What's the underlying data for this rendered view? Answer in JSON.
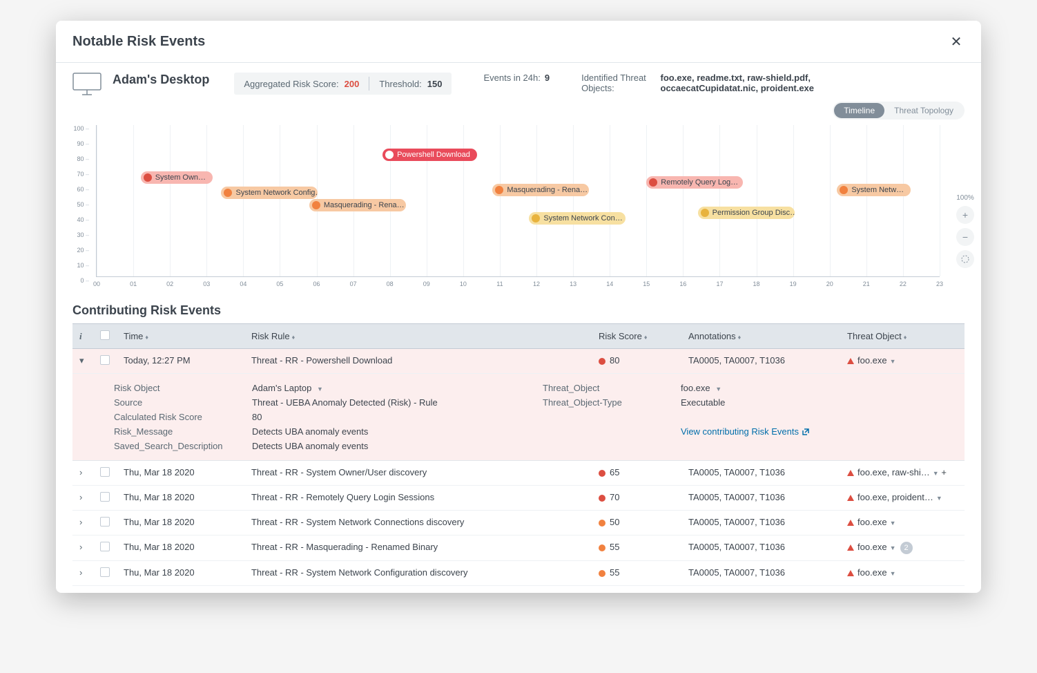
{
  "header": {
    "title": "Notable Risk Events"
  },
  "summary": {
    "device_name": "Adam's Desktop",
    "agg_label": "Aggregated Risk Score:",
    "agg_value": "200",
    "threshold_label": "Threshold:",
    "threshold_value": "150",
    "events_label": "Events in 24h:",
    "events_value": "9",
    "threats_label": "Identified Threat Objects:",
    "threats_value": "foo.exe, readme.txt, raw-shield.pdf, occaecatCupidatat.nic, proident.exe"
  },
  "view_toggle": {
    "timeline": "Timeline",
    "topology": "Threat Topology"
  },
  "zoom": {
    "level": "100%"
  },
  "chart_data": {
    "type": "scatter",
    "xlabel": "",
    "ylabel": "",
    "ylim": [
      0,
      100
    ],
    "xlim": [
      0,
      23
    ],
    "y_ticks": [
      0,
      10,
      20,
      30,
      40,
      50,
      60,
      70,
      80,
      90,
      100
    ],
    "x_ticks": [
      "00",
      "01",
      "02",
      "03",
      "04",
      "05",
      "06",
      "07",
      "08",
      "09",
      "10",
      "11",
      "12",
      "13",
      "14",
      "15",
      "16",
      "17",
      "18",
      "19",
      "20",
      "21",
      "22",
      "23"
    ],
    "events": [
      {
        "x": 1.2,
        "y": 65,
        "label": "System Own…",
        "color": "red"
      },
      {
        "x": 3.4,
        "y": 55,
        "label": "System Network Config…",
        "color": "orange"
      },
      {
        "x": 5.8,
        "y": 47,
        "label": "Masquerading - Rena…",
        "color": "orange"
      },
      {
        "x": 7.8,
        "y": 80,
        "label": "Powershell Download",
        "color": "red-strong"
      },
      {
        "x": 10.8,
        "y": 57,
        "label": "Masquerading - Rena…",
        "color": "orange"
      },
      {
        "x": 11.8,
        "y": 38,
        "label": "System Network Con…",
        "color": "yellow"
      },
      {
        "x": 15.0,
        "y": 62,
        "label": "Remotely Query Log…",
        "color": "red"
      },
      {
        "x": 16.4,
        "y": 42,
        "label": "Permission Group Disc…",
        "color": "yellow"
      },
      {
        "x": 20.2,
        "y": 57,
        "label": "System Netw…",
        "color": "orange"
      }
    ]
  },
  "table": {
    "title": "Contributing Risk Events",
    "cols": {
      "time": "Time",
      "rule": "Risk Rule",
      "score": "Risk Score",
      "annot": "Annotations",
      "threat": "Threat Object"
    },
    "rows": [
      {
        "expanded": true,
        "time": "Today, 12:27 PM",
        "rule": "Threat - RR - Powershell Download",
        "score": "80",
        "score_color": "r-red",
        "annot": "TA0005, TA0007, T1036",
        "threat": "foo.exe"
      },
      {
        "expanded": false,
        "time": "Thu, Mar 18 2020",
        "rule": "Threat - RR - System Owner/User discovery",
        "score": "65",
        "score_color": "r-red",
        "annot": "TA0005, TA0007, T1036",
        "threat": "foo.exe, raw-shi…",
        "extra_plus": "+"
      },
      {
        "expanded": false,
        "time": "Thu, Mar 18 2020",
        "rule": "Threat - RR - Remotely Query Login Sessions",
        "score": "70",
        "score_color": "r-red",
        "annot": "TA0005, TA0007, T1036",
        "threat": "foo.exe, proident…"
      },
      {
        "expanded": false,
        "time": "Thu, Mar 18 2020",
        "rule": "Threat - RR - System Network Connections discovery",
        "score": "50",
        "score_color": "r-orange",
        "annot": "TA0005, TA0007, T1036",
        "threat": "foo.exe"
      },
      {
        "expanded": false,
        "time": "Thu, Mar 18 2020",
        "rule": "Threat - RR - Masquerading - Renamed Binary",
        "score": "55",
        "score_color": "r-orange",
        "annot": "TA0005, TA0007, T1036",
        "threat": "foo.exe",
        "badge": "2"
      },
      {
        "expanded": false,
        "time": "Thu, Mar 18 2020",
        "rule": "Threat - RR - System Network Configuration discovery",
        "score": "55",
        "score_color": "r-orange",
        "annot": "TA0005, TA0007, T1036",
        "threat": "foo.exe"
      }
    ],
    "detail": {
      "risk_object_k": "Risk Object",
      "risk_object_v": "Adam's Laptop",
      "source_k": "Source",
      "source_v": "Threat - UEBA Anomaly Detected (Risk) - Rule",
      "calc_k": "Calculated Risk Score",
      "calc_v": "80",
      "msg_k": "Risk_Message",
      "msg_v": "Detects UBA anomaly events",
      "search_k": "Saved_Search_Description",
      "search_v": "Detects UBA anomaly events",
      "tobj_k": "Threat_Object",
      "tobj_v": "foo.exe",
      "ttype_k": "Threat_Object-Type",
      "ttype_v": "Executable",
      "link": "View contributing Risk Events"
    }
  }
}
